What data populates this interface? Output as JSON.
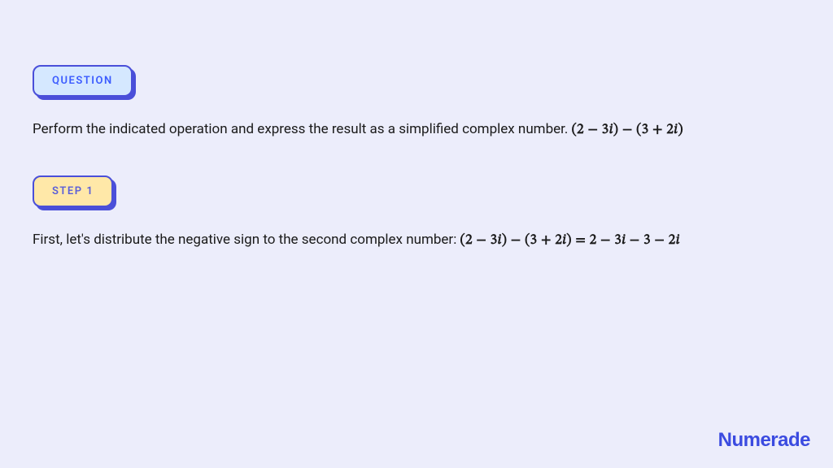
{
  "question_badge": "QUESTION",
  "question_text_prefix": "Perform the indicated operation and express the result as a simplified complex number. ",
  "question_math": "(2 − 3𝑖) − (3 + 2𝑖)",
  "step_badge": "STEP 1",
  "step_text_prefix": "First, let's distribute the negative sign to the second complex number: ",
  "step_math": "(2 − 3𝑖) − (3 + 2𝑖) = 2 − 3𝑖 − 3 − 2𝑖",
  "brand": "Numerade"
}
